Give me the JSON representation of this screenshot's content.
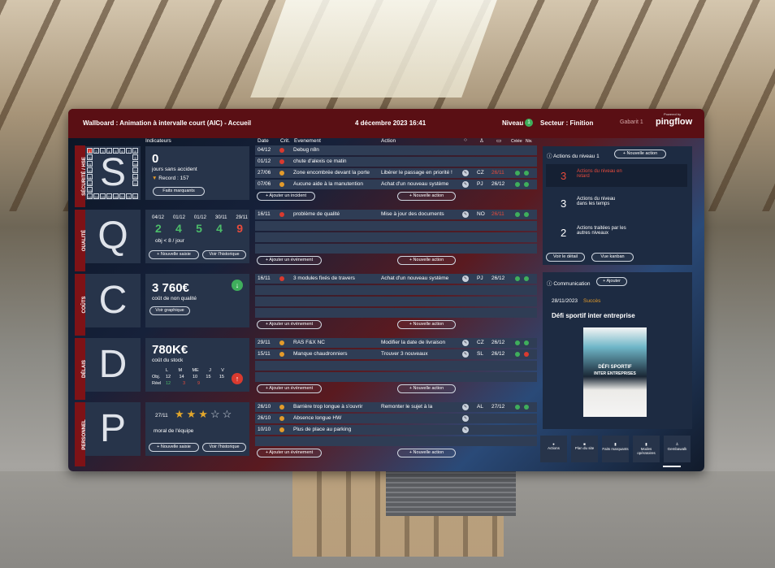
{
  "header": {
    "title": "Wallboard : Animation à intervalle court (AIC) - Accueil",
    "date": "4 décembre 2023 16:41",
    "niveau_label": "Niveau",
    "niveau_value": "1",
    "secteur": "Secteur : Finition",
    "gabarit": "Gabarit 1",
    "brand": "pingflow",
    "brand_small": "Powered by"
  },
  "columns": {
    "indicateurs": "Indicateurs",
    "date": "Date",
    "crit": "Crit.",
    "evenement": "Evenement",
    "action": "Action",
    "creee": "Créée",
    "niv": "Niv."
  },
  "rows": [
    {
      "id": "securite",
      "side": "SÉCURITÉ / HSE",
      "letter": "S",
      "value": "0",
      "subtitle": "jours sans accident",
      "record": "Record : 157",
      "btn": "Faits marquants",
      "calendar": [
        "1",
        "2",
        "3",
        "4",
        "5",
        "6",
        "7",
        "8",
        "30",
        "31",
        "9",
        "10",
        "28",
        "11",
        "27",
        "12",
        "26",
        "13",
        "25",
        "14",
        "24",
        "15",
        "23",
        "16",
        "22",
        "21",
        "20",
        "19",
        "18",
        "17"
      ],
      "events": [
        {
          "date": "04/12",
          "crit": "red",
          "text": "Debug n8n",
          "action": "",
          "who": "",
          "due": ""
        },
        {
          "date": "01/12",
          "crit": "red",
          "text": "chute d'alexis ce matin",
          "action": "",
          "who": "",
          "due": ""
        },
        {
          "date": "27/06",
          "crit": "orange",
          "text": "Zone encombrée devant la porte",
          "action": "Libérer le passage en priorité !",
          "who": "CZ",
          "due": "26/11",
          "late": true
        },
        {
          "date": "07/06",
          "crit": "orange",
          "text": "Aucune aide à la manutention",
          "action": "Achat d'un nouveau système",
          "who": "PJ",
          "due": "26/12"
        }
      ],
      "add": "+ Ajouter un incident",
      "new": "+ Nouvelle action"
    },
    {
      "id": "qualite",
      "side": "QUALITÉ",
      "letter": "Q",
      "dates": [
        "04/12",
        "01/12",
        "01/12",
        "30/11",
        "29/11"
      ],
      "values": [
        "2",
        "4",
        "5",
        "4",
        "9"
      ],
      "obj": "obj < 8 / jour",
      "btn1": "+ Nouvelle saisie",
      "btn2": "Voir l'historique",
      "events": [
        {
          "date": "16/11",
          "crit": "red",
          "text": "problème de qualité",
          "action": "Mise à jour des documents",
          "who": "NO",
          "due": "26/11",
          "late": true
        }
      ],
      "add": "+ Ajouter un événement",
      "new": "+ Nouvelle action"
    },
    {
      "id": "couts",
      "side": "COÛTS",
      "letter": "C",
      "value": "3 760€",
      "subtitle": "coût de non qualité",
      "btn": "Voir graphique",
      "events": [
        {
          "date": "16/11",
          "crit": "red",
          "text": "3 modules fixés de travers",
          "action": "Achat d'un nouveau système",
          "who": "PJ",
          "due": "26/12"
        }
      ],
      "add": "+ Ajouter un événement",
      "new": "+ Nouvelle action"
    },
    {
      "id": "delais",
      "side": "DÉLAIS",
      "letter": "D",
      "value": "780K€",
      "subtitle": "coût du stock",
      "days": [
        "L",
        "M",
        "ME",
        "J",
        "V"
      ],
      "obj_label": "Obj.",
      "obj": [
        "12",
        "14",
        "10",
        "15",
        "15"
      ],
      "reel_label": "Réel",
      "reel": [
        "12",
        "3",
        "9"
      ],
      "events": [
        {
          "date": "29/11",
          "crit": "orange",
          "text": "RAS F&X NC",
          "action": "Modifier la date de livraison",
          "who": "CZ",
          "due": "26/12"
        },
        {
          "date": "15/11",
          "crit": "orange",
          "text": "Manque chaudronniers",
          "action": "Trouver 3 nouveaux",
          "who": "SL",
          "due": "26/12"
        }
      ],
      "add": "+ Ajouter un événement",
      "new": "+ Nouvelle action"
    },
    {
      "id": "personnel",
      "side": "PERSONNEL",
      "letter": "P",
      "date": "27/11",
      "subtitle": "moral de l'équipe",
      "btn1": "+ Nouvelle saisie",
      "btn2": "Voir l'historique",
      "events": [
        {
          "date": "26/10",
          "crit": "orange",
          "text": "Barrière trop longue à s'ouvrir",
          "action": "Remonter le sujet à la",
          "who": "AL",
          "due": "27/12"
        },
        {
          "date": "26/10",
          "crit": "orange",
          "text": "Absence longue HW",
          "action": "",
          "who": "",
          "due": ""
        },
        {
          "date": "10/10",
          "crit": "orange",
          "text": "Plus de place au parking",
          "action": "",
          "who": "",
          "due": ""
        }
      ],
      "add": "+ Ajouter un événement",
      "new": "+ Nouvelle action"
    }
  ],
  "actions_panel": {
    "title": "Actions du niveau 1",
    "new": "+ Nouvelle action",
    "items": [
      {
        "n": "3",
        "label": "Actions du niveau en retard"
      },
      {
        "n": "3",
        "label": "Actions du niveau dans les temps"
      },
      {
        "n": "2",
        "label": "Actions traitées par les autres niveaux"
      }
    ],
    "detail": "Voir le détail",
    "kanban": "Vue kanban"
  },
  "comm": {
    "title": "Communication",
    "add": "+ Ajouter",
    "date": "28/11/2023",
    "tag": "Succès",
    "headline": "Défi sportif inter entreprise",
    "poster1": "DÉFI SPORTIF",
    "poster2": "INTER ENTREPRISES"
  },
  "bottom": [
    "Actions",
    "Plan du site",
    "Faits marquants",
    "Modes opératoires",
    "Gembawalk"
  ],
  "colors": {
    "accent": "#7e1216",
    "panel": "#27344a",
    "green": "#3fae5c",
    "red": "#d93a2f",
    "orange": "#e39b2b"
  }
}
